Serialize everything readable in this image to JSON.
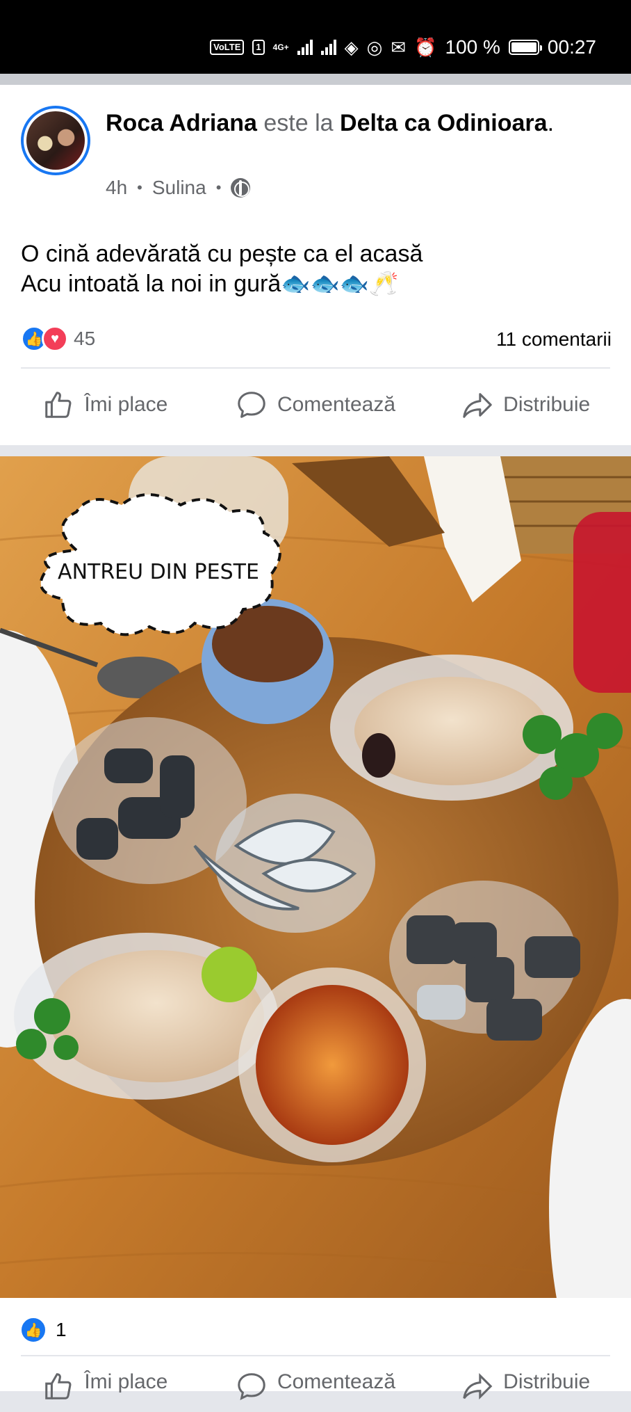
{
  "status_bar": {
    "carrier_chip": "VoLTE",
    "sim": "1",
    "network_type": "4G+",
    "battery_percent": "100 %",
    "time": "00:27",
    "battery_level": 1.0
  },
  "post": {
    "author": "Roca Adriana",
    "connector": "este la",
    "place": "Delta ca Odinioara",
    "place_suffix": ".",
    "time": "4h",
    "location": "Sulina",
    "audience_icon": "globe-icon",
    "text_line_1": "O cină adevărată cu pește ca el acasă",
    "text_line_2": "Acu intoată la noi in gură🐟🐟🐟🥂",
    "reaction_count": "45",
    "comments_count": "11 comentarii",
    "reaction_icons": [
      "like-icon",
      "love-icon"
    ]
  },
  "actions": {
    "like": "Îmi place",
    "comment": "Comentează",
    "share": "Distribuie"
  },
  "photo": {
    "sticker_text": "ANTREU DIN PESTE"
  },
  "photo_reactions": {
    "count": "1"
  },
  "colors": {
    "facebook_blue": "#1877f2",
    "love_red": "#f33e58",
    "muted_text": "#65676b"
  }
}
